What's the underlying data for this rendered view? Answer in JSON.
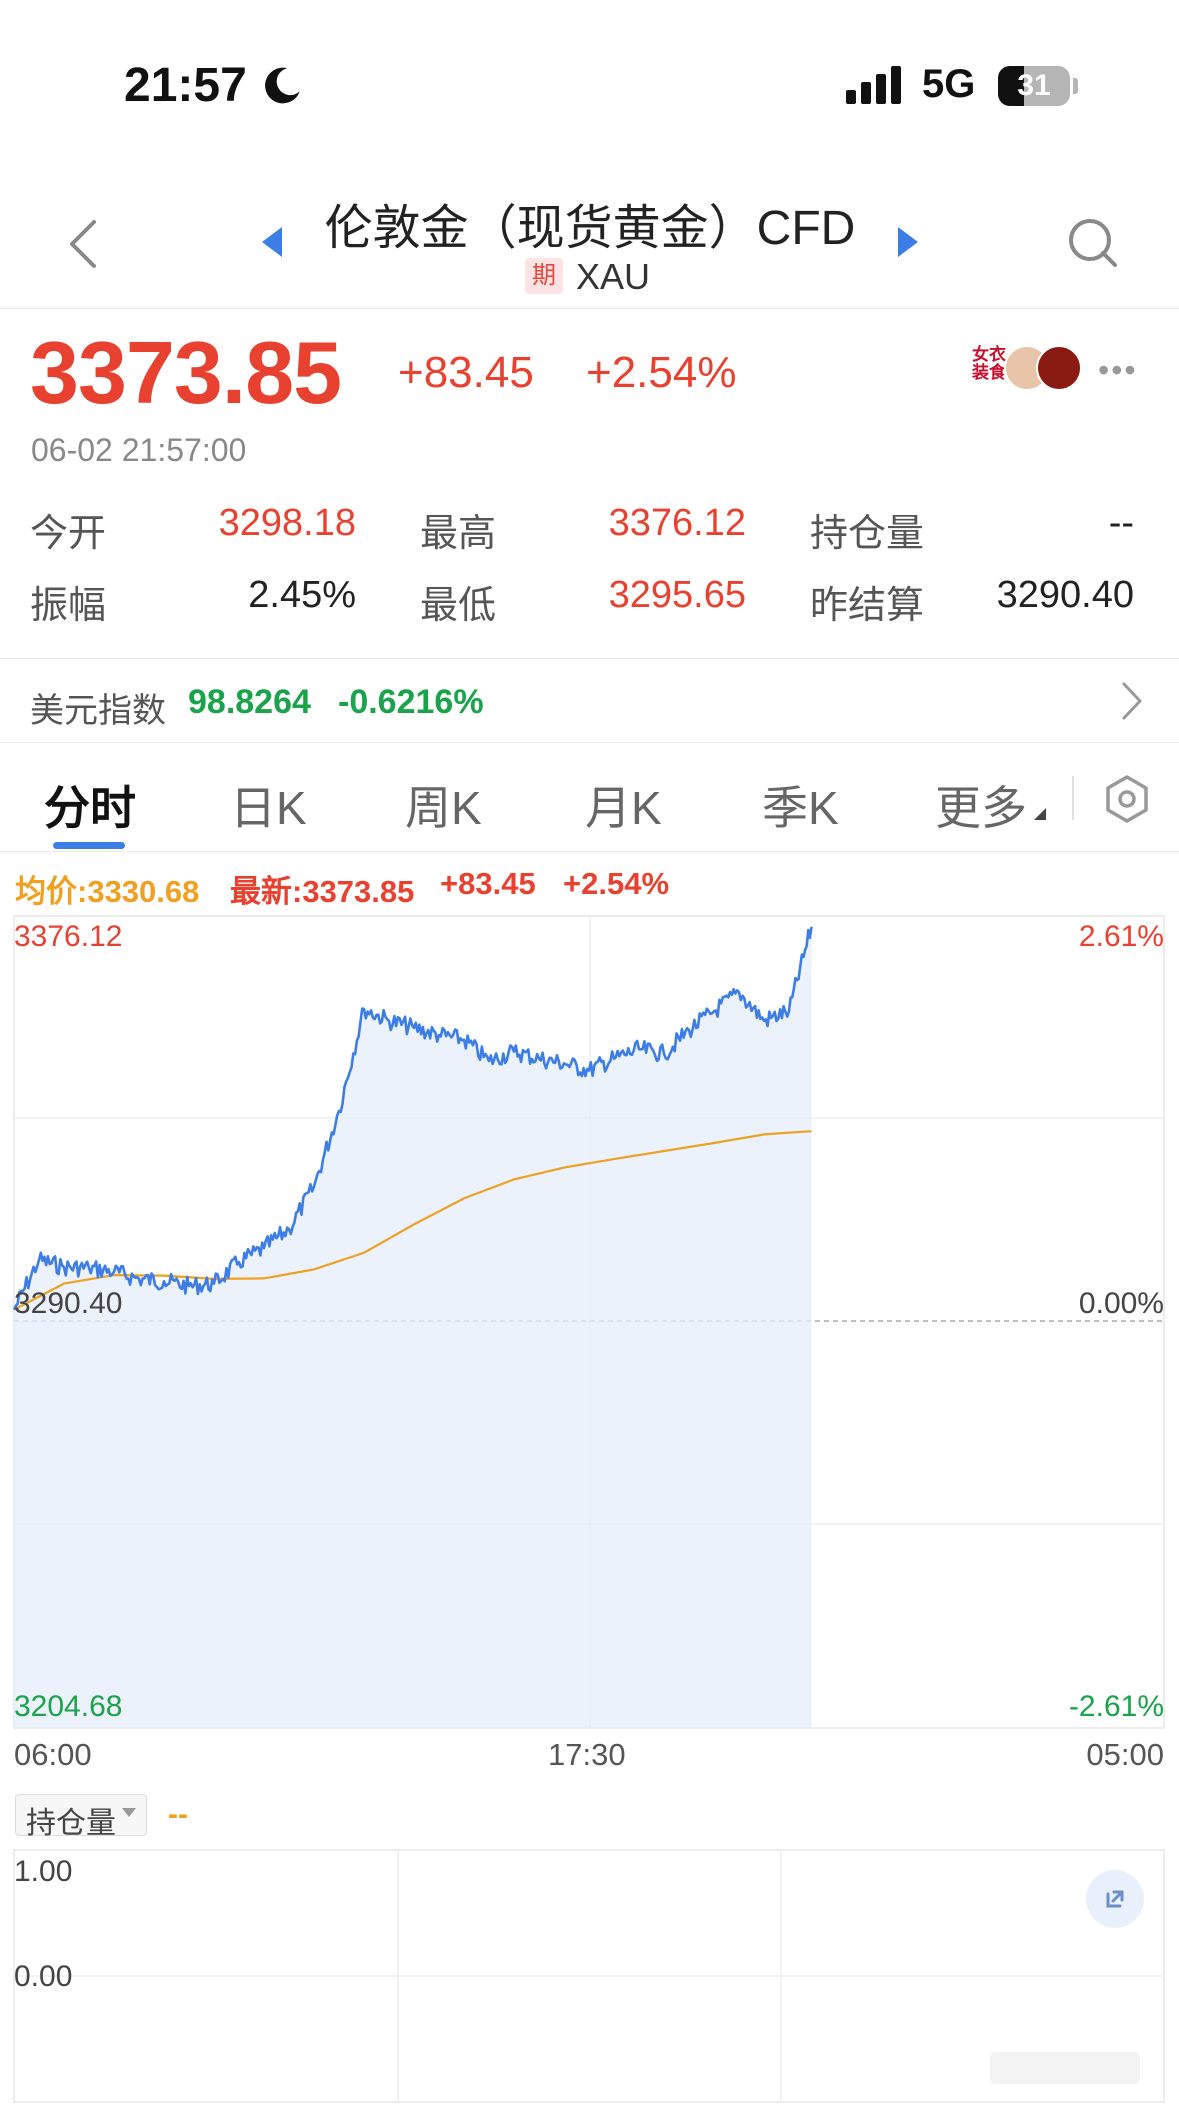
{
  "status": {
    "time": "21:57",
    "network": "5G",
    "battery": "31"
  },
  "header": {
    "title": "伦敦金（现货黄金）CFD",
    "badge": "期",
    "code": "XAU"
  },
  "quote": {
    "price": "3373.85",
    "change": "+83.45",
    "change_pct": "+2.54%",
    "timestamp": "06-02 21:57:00"
  },
  "avatars": {
    "badge_text": "女衣装食"
  },
  "stats": {
    "row1": [
      {
        "label": "今开",
        "value": "3298.18"
      },
      {
        "label": "最高",
        "value": "3376.12"
      },
      {
        "label": "持仓量",
        "value": "--"
      }
    ],
    "row2": [
      {
        "label": "振幅",
        "value": "2.45%"
      },
      {
        "label": "最低",
        "value": "3295.65"
      },
      {
        "label": "昨结算",
        "value": "3290.40"
      }
    ]
  },
  "usd_index": {
    "label": "美元指数",
    "value": "98.8264",
    "change_pct": "-0.6216%"
  },
  "tabs": [
    "分时",
    "日K",
    "周K",
    "月K",
    "季K",
    "更多"
  ],
  "chart_legend": {
    "avg_label": "均价:3330.68",
    "latest_label": "最新:3373.85",
    "change": "+83.45",
    "change_pct": "+2.54%"
  },
  "chart_axes": {
    "y_top": "3376.12",
    "y_mid": "3290.40",
    "y_bottom": "3204.68",
    "pct_top": "2.61%",
    "pct_mid": "0.00%",
    "pct_bottom": "-2.61%",
    "x_start": "06:00",
    "x_mid": "17:30",
    "x_end": "05:00"
  },
  "open_interest": {
    "label": "持仓量",
    "value": "--",
    "y_top": "1.00",
    "y_zero": "0.00"
  },
  "colors": {
    "up": "#e8412f",
    "down": "#1aa34a",
    "price_line": "#3d7ee6",
    "avg_line": "#f0a020"
  },
  "chart_data": {
    "type": "line",
    "title": "",
    "xlabel": "",
    "ylabel": "",
    "x_ticks": [
      "06:00",
      "17:30",
      "05:00"
    ],
    "ylim": [
      3204.68,
      3376.12
    ],
    "reference_line": 3290.4,
    "series": [
      {
        "name": "最新",
        "x": [
          "06:00",
          "06:30",
          "07:00",
          "07:30",
          "08:00",
          "08:30",
          "09:00",
          "09:30",
          "10:00",
          "10:30",
          "11:00",
          "11:30",
          "12:00",
          "12:30",
          "13:00",
          "13:30",
          "14:00",
          "14:30",
          "15:00",
          "15:30",
          "16:00",
          "16:30",
          "17:00",
          "17:30",
          "18:00",
          "18:30",
          "19:00",
          "19:30",
          "20:00",
          "20:30",
          "21:00",
          "21:30",
          "21:57"
        ],
        "values": [
          3293.0,
          3303.5,
          3302.0,
          3301.8,
          3301.0,
          3299.5,
          3299.0,
          3298.0,
          3298.5,
          3303.0,
          3306.0,
          3310.0,
          3319.0,
          3335.0,
          3356.5,
          3354.0,
          3352.5,
          3351.0,
          3350.0,
          3345.5,
          3347.5,
          3346.0,
          3345.0,
          3343.5,
          3346.0,
          3348.0,
          3347.0,
          3352.0,
          3356.0,
          3360.0,
          3354.0,
          3356.0,
          3373.85
        ]
      },
      {
        "name": "均价",
        "x": [
          "06:00",
          "07:00",
          "08:00",
          "09:00",
          "10:00",
          "11:00",
          "12:00",
          "13:00",
          "14:00",
          "15:00",
          "16:00",
          "17:00",
          "18:00",
          "19:00",
          "20:00",
          "21:00",
          "21:57"
        ],
        "values": [
          3293.0,
          3298.5,
          3300.3,
          3300.2,
          3299.5,
          3299.6,
          3301.5,
          3305.0,
          3311.0,
          3316.5,
          3320.5,
          3323.0,
          3324.8,
          3326.5,
          3328.2,
          3330.0,
          3330.68
        ]
      }
    ]
  }
}
